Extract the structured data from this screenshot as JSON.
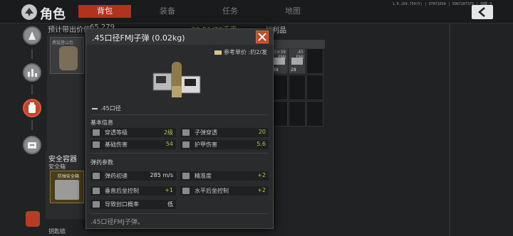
{
  "topbar": {
    "title": "角色",
    "tabs": [
      {
        "label": "背包",
        "active": true
      },
      {
        "label": "装备",
        "active": false
      },
      {
        "label": "任务",
        "active": false
      },
      {
        "label": "地图",
        "active": false
      }
    ],
    "version_text": "1.0.159.759(5) | 07071650 | 5067207379 | 加载-3"
  },
  "background": {
    "carry_value_label": "预计带出价值:",
    "carry_value": "65,279",
    "weight": "30.51/70千克",
    "spoils_label": "战利品",
    "bag_label": "勇猛登山包",
    "safe_container_title": "安全容器",
    "safe_container_sub": "安全箱",
    "safe_item_label": "防弹安全箱",
    "keychain_label": "钥匙链",
    "spoil_cells": [
      {
        "text": ".45×39\nFMJ",
        "count": "38"
      },
      {
        "text": ".45\nFMJ",
        "count": "28"
      }
    ]
  },
  "tooltip": {
    "name": ".45口径FMJ子弹 (0.02kg)",
    "unit_price": "参考单价 :约2/发",
    "caliber": ".45口径",
    "basic_info_title": "基本信息",
    "basic_stats": [
      {
        "label": "穿透等级",
        "value": "2级",
        "icon": "shield-level-icon"
      },
      {
        "label": "子弹穿透",
        "value": "20",
        "icon": "penetration-icon"
      },
      {
        "label": "基础伤害",
        "value": "54",
        "icon": "heart-icon"
      },
      {
        "label": "护甲伤害",
        "value": "5.6",
        "icon": "armor-icon"
      }
    ],
    "ammo_params_title": "弹药参数",
    "ammo_stats": [
      {
        "label": "弹药初速",
        "value": "285 m/s",
        "icon": "velocity-icon",
        "white": true
      },
      {
        "label": "精准度",
        "value": "+2",
        "icon": "crosshair-icon",
        "white": false
      },
      {
        "label": "垂直后坐控制",
        "value": "+1",
        "icon": "vertical-recoil-icon",
        "white": false
      },
      {
        "label": "水平后坐控制",
        "value": "+2",
        "icon": "horizontal-recoil-icon",
        "white": false
      },
      {
        "label": "导致创口概率",
        "value": "低",
        "icon": "wound-icon",
        "white": false
      }
    ],
    "description": ".45口径FMJ子弹。"
  },
  "colors": {
    "accent_red": "#b2331c",
    "stat_green": "#a8c84a"
  }
}
